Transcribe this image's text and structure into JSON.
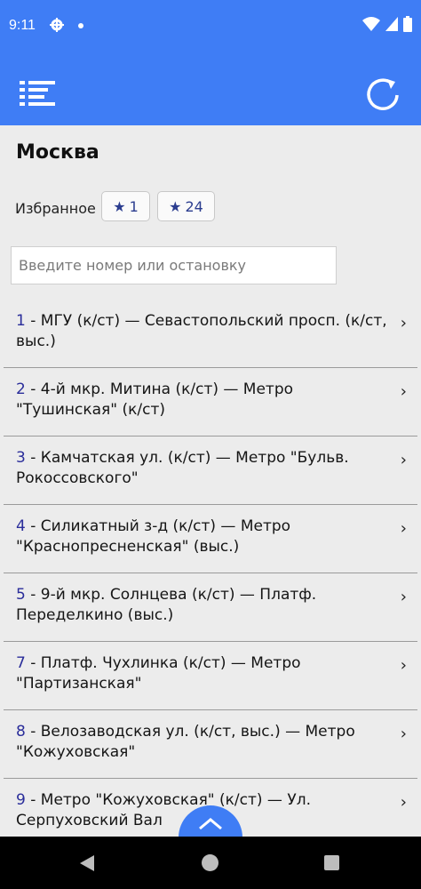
{
  "status": {
    "time": "9:11"
  },
  "icons": {
    "menu": "list-menu-icon",
    "refresh": "refresh-icon",
    "scroll_top": "chevron-up-icon"
  },
  "colors": {
    "primary": "#3f7df5",
    "route_number": "#2a2d9a"
  },
  "city_title": "Москва",
  "favorites": {
    "label": "Избранное",
    "buttons": [
      {
        "star": "★",
        "value": "1"
      },
      {
        "star": "★",
        "value": "24"
      }
    ]
  },
  "search": {
    "placeholder": "Введите номер или остановку",
    "value": ""
  },
  "routes": [
    {
      "number": "1",
      "text": " - МГУ (к/ст) — Севастопольский просп. (к/ст, выс.)"
    },
    {
      "number": "2",
      "text": " - 4-й мкр. Митина (к/ст) — Метро \"Тушинская\" (к/ст)"
    },
    {
      "number": "3",
      "text": " - Камчатская ул. (к/ст) — Метро \"Бульв. Рокоссовского\""
    },
    {
      "number": "4",
      "text": " - Силикатный з-д (к/ст) — Метро \"Краснопресненская\" (выс.)"
    },
    {
      "number": "5",
      "text": " - 9-й мкр. Солнцева (к/ст) — Платф. Переделкино (выс.)"
    },
    {
      "number": "7",
      "text": " - Платф. Чухлинка (к/ст) — Метро \"Партизанская\""
    },
    {
      "number": "8",
      "text": " - Велозаводская ул. (к/ст, выс.) — Метро \"Кожуховская\""
    },
    {
      "number": "9",
      "text": " - Метро \"Кожуховская\" (к/ст) — Ул. Серпуховский Вал"
    }
  ],
  "chevron": "›"
}
